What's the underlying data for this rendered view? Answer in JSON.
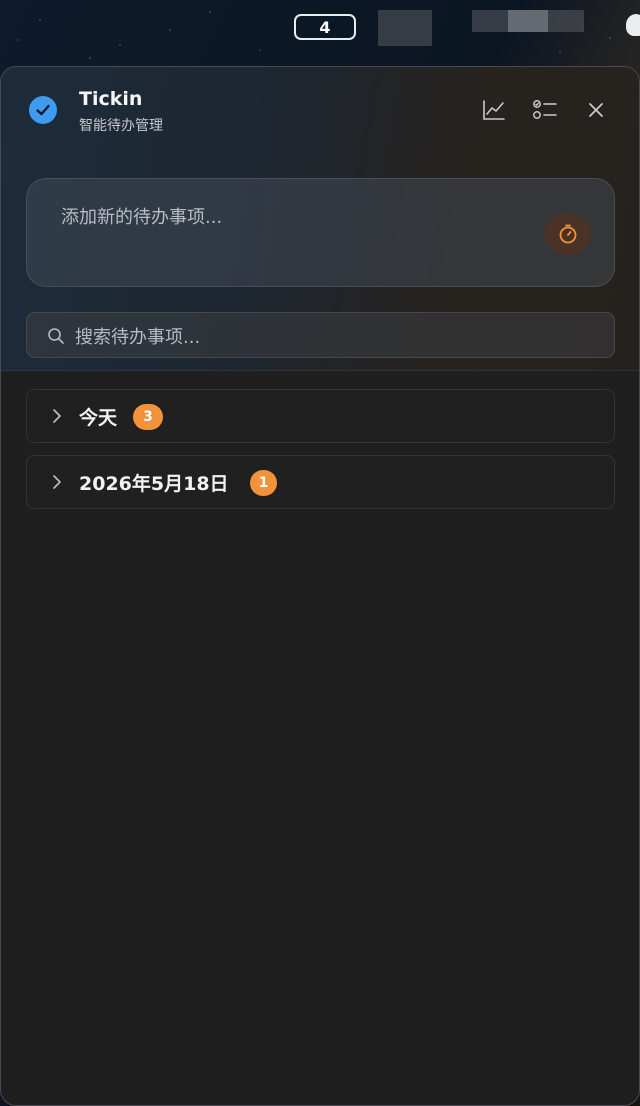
{
  "menubar": {
    "workspace_badge": "4"
  },
  "app": {
    "title": "Tickin",
    "subtitle": "智能待办管理"
  },
  "toolbar": {
    "stats_icon": "line-chart-icon",
    "list_icon": "checklist-icon",
    "close_icon": "close-icon"
  },
  "add_todo": {
    "placeholder": "添加新的待办事项...",
    "timer_icon": "timer-icon"
  },
  "search": {
    "placeholder": "搜索待办事项..."
  },
  "groups": [
    {
      "label": "今天",
      "count": "3"
    },
    {
      "label": "2026年5月18日",
      "count": "1"
    }
  ],
  "colors": {
    "accent_blue": "#3d9bf0",
    "accent_orange": "#f2923a",
    "panel_bg": "#1f1f1f"
  }
}
